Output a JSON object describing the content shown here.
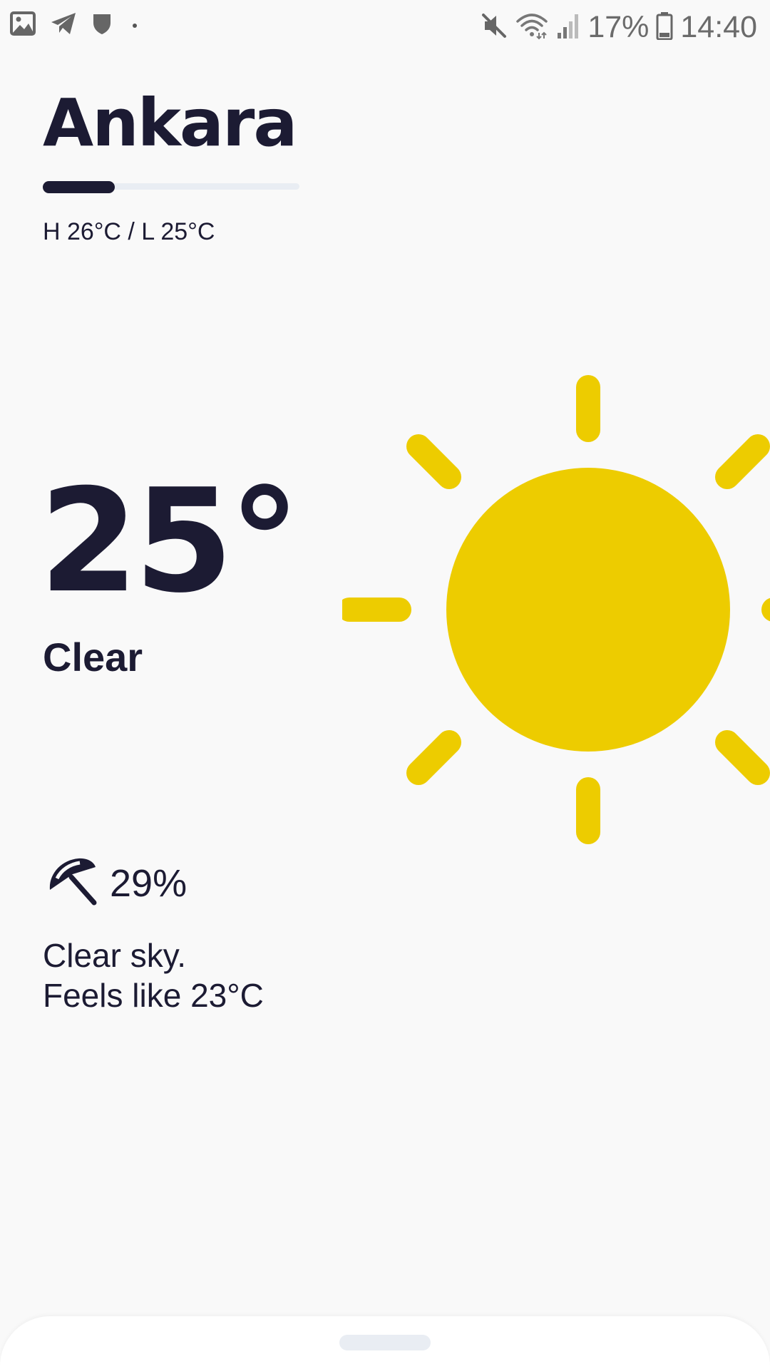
{
  "status_bar": {
    "battery": "17%",
    "time": "14:40",
    "icons_left": [
      "gallery-icon",
      "telegram-icon",
      "shield-icon"
    ],
    "icons_right": [
      "mute-icon",
      "wifi-icon",
      "signal-icon",
      "battery-icon"
    ]
  },
  "weather": {
    "city": "Ankara",
    "day_progress": 0.28,
    "high_low": "H 26°C / L 25°C",
    "temperature": "25°",
    "condition": "Clear",
    "precipitation": "29%",
    "description_line1": "Clear sky.",
    "description_line2": "Feels like 23°C",
    "icon": "sun-icon"
  },
  "colors": {
    "text": "#1c1b33",
    "sun": "#edcc00",
    "background": "#f9f9f9",
    "track": "#e9edf3"
  }
}
